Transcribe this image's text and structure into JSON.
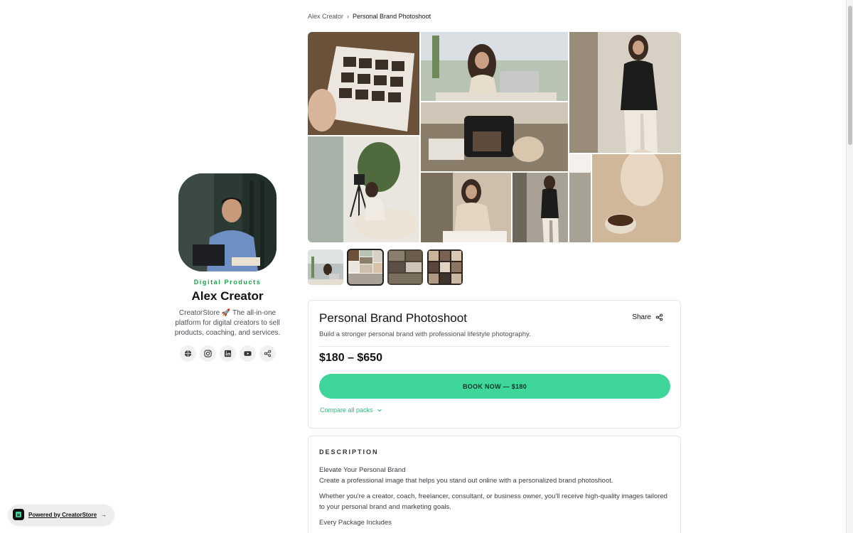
{
  "breadcrumb": {
    "parent": "Alex Creator",
    "separator": "›",
    "current": "Personal Brand Photoshoot"
  },
  "profile": {
    "category": "Digital Products",
    "name": "Alex Creator",
    "bio": "CreatorStore 🚀 The all-in-one platform for digital creators to sell products, coaching, and services.",
    "socials": [
      "globe-icon",
      "instagram-icon",
      "linkedin-icon",
      "youtube-icon",
      "share-icon"
    ]
  },
  "gallery": {
    "thumbnails": 4,
    "active_thumbnail": 2
  },
  "product": {
    "title": "Personal Brand Photoshoot",
    "share_label": "Share",
    "subtitle": "Build a stronger personal brand with professional lifestyle photography.",
    "price": "$180 – $650",
    "book_label": "BOOK NOW — $180",
    "compare_label": "Compare all packs"
  },
  "description": {
    "heading": "DESCRIPTION",
    "line1": "Elevate Your Personal Brand",
    "line2": "Create a professional image that helps you stand out online with a personalized brand photoshoot.",
    "para2": "Whether you're a creator, coach, freelancer, consultant, or business owner, you'll receive high-quality images tailored to your personal brand and marketing goals.",
    "line3": "Every Package Includes"
  },
  "powered": {
    "label": "Powered by CreatorStore",
    "arrow": "→"
  },
  "colors": {
    "accent": "#3ed699",
    "accent_text": "#2fb87c",
    "category": "#1aa34a"
  }
}
